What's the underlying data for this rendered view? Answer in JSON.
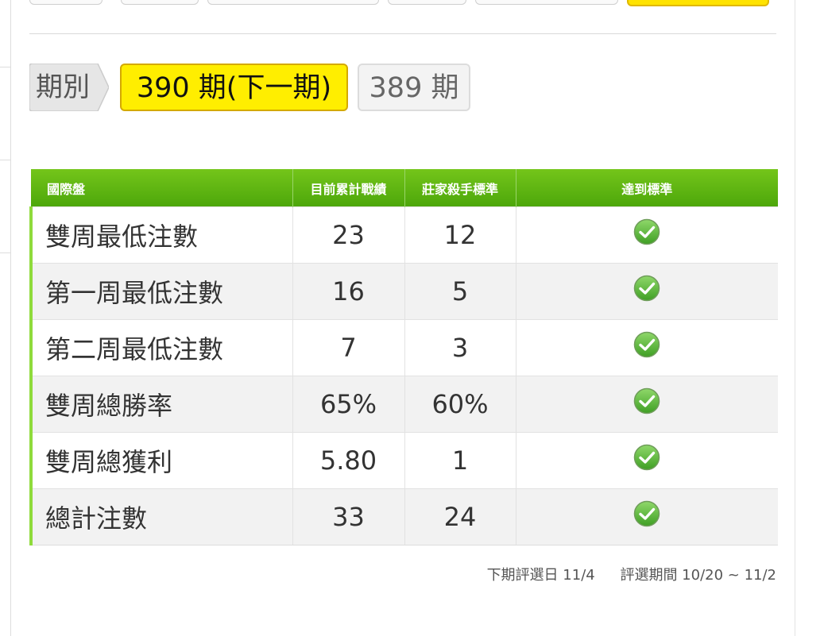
{
  "period": {
    "label": "期別",
    "tabs": [
      {
        "label": "390 期(下一期)",
        "active": true
      },
      {
        "label": "389 期",
        "active": false
      }
    ]
  },
  "table": {
    "headers": [
      "國際盤",
      "目前累計戰績",
      "莊家殺手標準",
      "達到標準"
    ],
    "rows": [
      {
        "name": "雙周最低注數",
        "current": "23",
        "standard": "12",
        "met": "check-icon"
      },
      {
        "name": "第一周最低注數",
        "current": "16",
        "standard": "5",
        "met": "check-icon"
      },
      {
        "name": "第二周最低注數",
        "current": "7",
        "standard": "3",
        "met": "check-icon"
      },
      {
        "name": "雙周總勝率",
        "current": "65%",
        "standard": "60%",
        "met": "check-icon"
      },
      {
        "name": "雙周總獲利",
        "current": "5.80",
        "standard": "1",
        "met": "check-icon"
      },
      {
        "name": "總計注數",
        "current": "33",
        "standard": "24",
        "met": "check-icon"
      }
    ]
  },
  "footer": {
    "next_selection": "下期評選日 11/4",
    "selection_period": "評選期間 10/20 ~ 11/2"
  },
  "colors": {
    "header_green": "#5cb512",
    "active_tab_yellow": "#ffee00",
    "row_accent": "#8fdb3c",
    "check_green": "#5cb83a"
  }
}
